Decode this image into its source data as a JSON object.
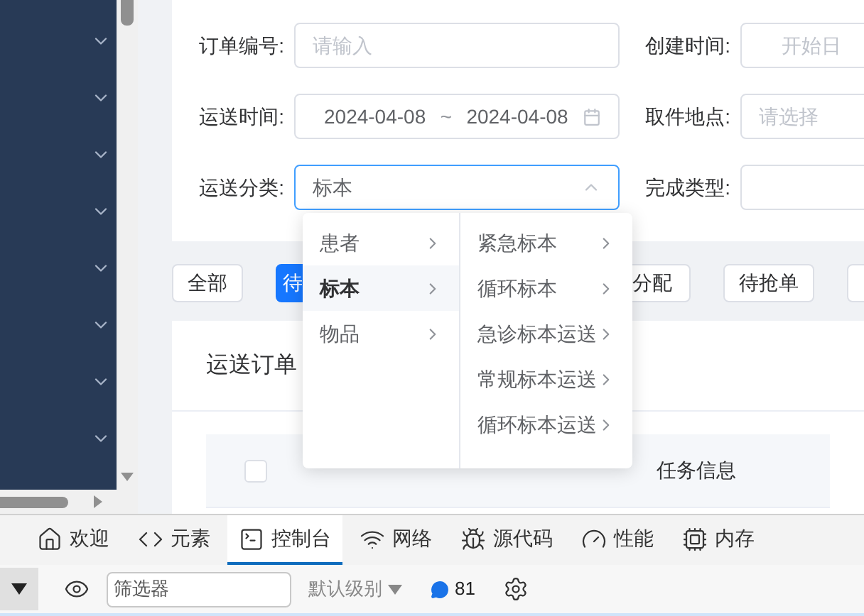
{
  "sidebar": {
    "items": [
      {
        "expanded": false
      },
      {
        "expanded": false
      },
      {
        "expanded": false
      },
      {
        "expanded": false
      },
      {
        "expanded": false
      },
      {
        "expanded": false
      },
      {
        "expanded": false
      },
      {
        "expanded": false
      }
    ]
  },
  "form": {
    "rows": [
      [
        {
          "label": "订单编号:",
          "kind": "text",
          "placeholder": "请输入"
        },
        {
          "label": "创建时间:",
          "kind": "date",
          "placeholder": "开始日"
        }
      ],
      [
        {
          "label": "运送时间:",
          "kind": "daterange",
          "start": "2024-04-08",
          "separator": "~",
          "end": "2024-04-08"
        },
        {
          "label": "取件地点:",
          "kind": "select",
          "placeholder": "请选择"
        }
      ],
      [
        {
          "label": "运送分类:",
          "kind": "cascader",
          "value": "标本",
          "expanded": true
        },
        {
          "label": "完成类型:",
          "kind": "select"
        }
      ]
    ]
  },
  "filter_buttons": [
    {
      "label": "全部",
      "kind": "full",
      "selected": false
    },
    {
      "label": "待",
      "kind": "cut_right",
      "selected": true
    },
    {
      "label": "分配",
      "kind": "cut_left",
      "selected": false
    },
    {
      "label": "待抢单",
      "kind": "full",
      "selected": false
    },
    {
      "kind": "cut_edge",
      "selected": false
    }
  ],
  "order_card": {
    "title": "运送订单",
    "table": {
      "columns": [
        {
          "kind": "checkbox",
          "checked": false
        },
        {
          "kind": "blank"
        },
        {
          "kind": "blank"
        },
        {
          "kind": "text",
          "label": "任务信息"
        }
      ]
    }
  },
  "cascader_menu": {
    "columns": [
      [
        {
          "label": "患者",
          "selected": false
        },
        {
          "label": "标本",
          "selected": true
        },
        {
          "label": "物品",
          "selected": false
        }
      ],
      [
        {
          "label": "紧急标本",
          "selected": false
        },
        {
          "label": "循环标本",
          "selected": false
        },
        {
          "label": "急诊标本运送",
          "selected": false
        },
        {
          "label": "常规标本运送",
          "selected": false
        },
        {
          "label": "循环标本运送",
          "selected": false
        }
      ]
    ]
  },
  "devtools": {
    "tabs": [
      {
        "label": "欢迎",
        "selected": false
      },
      {
        "label": "元素",
        "selected": false
      },
      {
        "label": "控制台",
        "selected": true
      },
      {
        "label": "网络",
        "selected": false
      },
      {
        "label": "源代码",
        "selected": false
      },
      {
        "label": "性能",
        "selected": false
      },
      {
        "label": "内存",
        "selected": false
      }
    ],
    "toolbar": {
      "filter_placeholder": "筛选器",
      "level": "默认级别",
      "message_count": "81"
    }
  }
}
